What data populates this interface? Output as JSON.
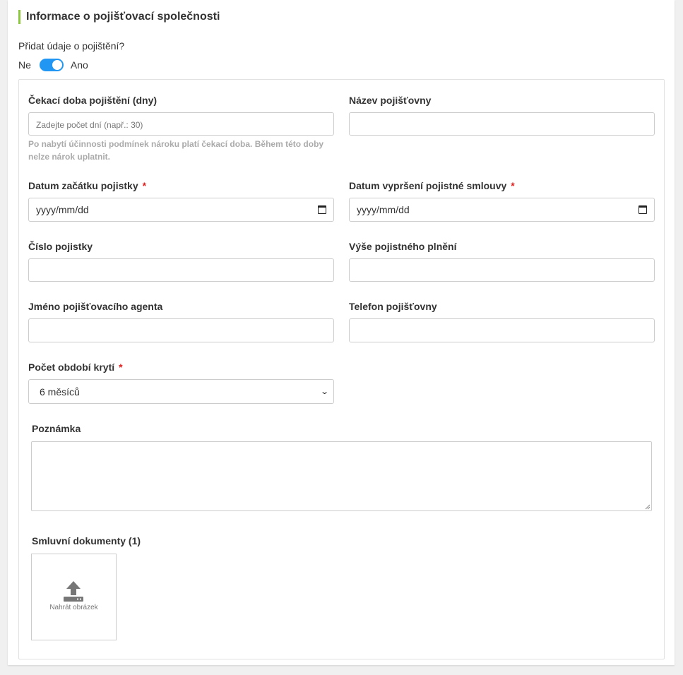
{
  "section": {
    "title": "Informace o pojišťovací společnosti"
  },
  "insurance_toggle": {
    "question": "Přidat údaje o pojištění?",
    "off_label": "Ne",
    "on_label": "Ano",
    "enabled": true
  },
  "fields": {
    "waiting_period": {
      "label": "Čekací doba pojištění (dny)",
      "placeholder": "Zadejte počet dní (např.: 30)",
      "hint": "Po nabytí účinnosti podmínek nároku platí čekací doba. Během této doby nelze nárok uplatnit."
    },
    "insurer_name": {
      "label": "Název pojišťovny",
      "value": ""
    },
    "start_date": {
      "label": "Datum začátku pojistky",
      "required": "*",
      "value": "yyyy/mm/dd"
    },
    "end_date": {
      "label": "Datum vypršení pojistné smlouvy",
      "required": "*",
      "value": "yyyy/mm/dd"
    },
    "policy_number": {
      "label": "Číslo pojistky",
      "value": ""
    },
    "benefit_amount": {
      "label": "Výše pojistného plnění",
      "value": ""
    },
    "agent_name": {
      "label": "Jméno pojišťovacího agenta",
      "value": ""
    },
    "insurer_phone": {
      "label": "Telefon pojišťovny",
      "value": ""
    },
    "coverage_periods": {
      "label": "Počet období krytí",
      "required": "*",
      "selected": "6 měsíců"
    },
    "note": {
      "label": "Poznámka",
      "value": ""
    },
    "documents": {
      "label": "Smluvní dokumenty (1)",
      "upload_label": "Nahrát obrázek"
    }
  },
  "colors": {
    "accent_bar": "#8dc63f",
    "toggle": "#2196f3",
    "required": "#e02020"
  }
}
